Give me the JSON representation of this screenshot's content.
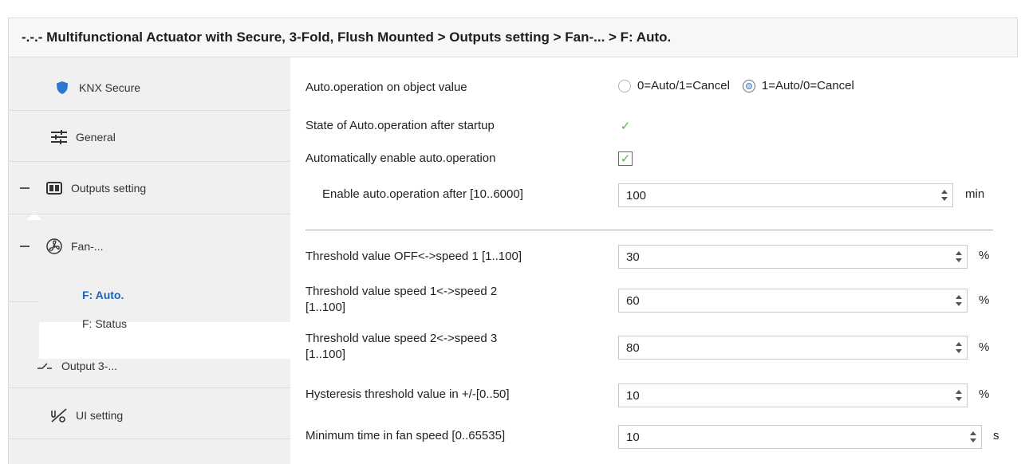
{
  "breadcrumb": "-.-.- Multifunctional Actuator with Secure, 3-Fold, Flush Mounted > Outputs setting > Fan-... > F: Auto.",
  "sidebar": {
    "knx_secure": "KNX Secure",
    "general": "General",
    "outputs_setting": "Outputs setting",
    "fan": "Fan-...",
    "f_auto": "F: Auto.",
    "f_status": "F: Status",
    "output3": "Output 3-...",
    "ui_setting": "UI setting"
  },
  "params": {
    "auto_on_object": {
      "label": "Auto.operation on object value",
      "options": [
        "0=Auto/1=Cancel",
        "1=Auto/0=Cancel"
      ],
      "selected": "1=Auto/0=Cancel"
    },
    "state_after_startup": {
      "label": "State of Auto.operation after startup",
      "checked": true
    },
    "auto_enable": {
      "label": "Automatically enable auto.operation",
      "checked": true
    },
    "enable_after": {
      "label": "Enable auto.operation after [10..6000]",
      "value": "100",
      "unit": "min"
    },
    "threshold_off_1": {
      "label": "Threshold value OFF<->speed 1 [1..100]",
      "value": "30",
      "unit": "%"
    },
    "threshold_1_2": {
      "label_line1": "Threshold value speed 1<->speed 2",
      "label_line2": "[1..100]",
      "value": "60",
      "unit": "%"
    },
    "threshold_2_3": {
      "label_line1": "Threshold value speed 2<->speed 3",
      "label_line2": "[1..100]",
      "value": "80",
      "unit": "%"
    },
    "hysteresis": {
      "label": "Hysteresis threshold value in +/-[0..50]",
      "value": "10",
      "unit": "%"
    },
    "min_time": {
      "label": "Minimum time in fan speed [0..65535]",
      "value": "10",
      "unit": "s"
    }
  },
  "colors": {
    "accent": "#1b62b5",
    "check": "#59b04b",
    "shield": "#2b78d0"
  },
  "icons": [
    "shield-icon",
    "sliders-icon",
    "grid-icon",
    "fan-icon",
    "switch-icon",
    "ui-setting-icon",
    "spinner-up-icon",
    "spinner-down-icon"
  ]
}
